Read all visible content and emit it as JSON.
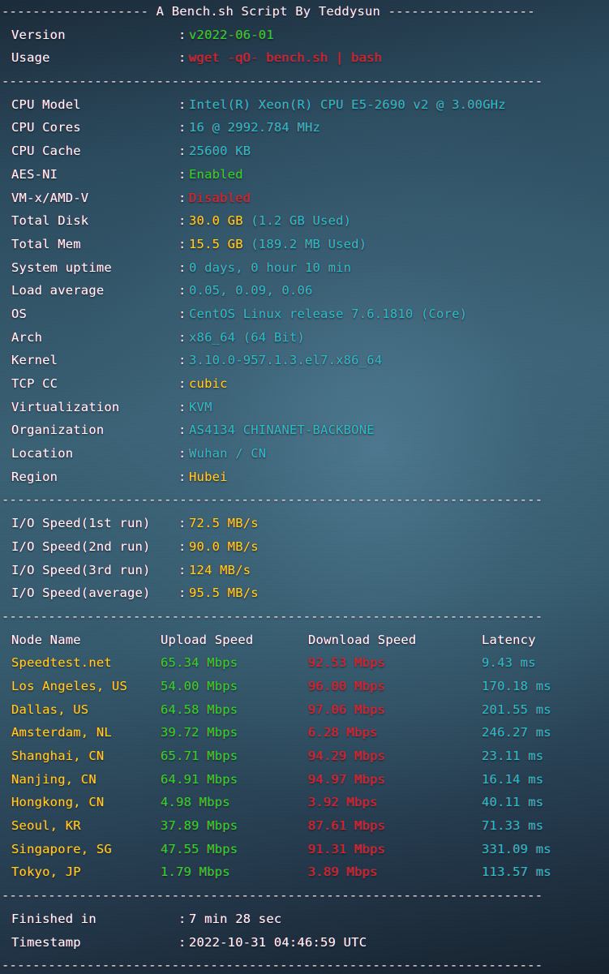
{
  "header": {
    "title": "A Bench.sh Script By Teddysun",
    "dash_left": "-------------------",
    "dash_right": "-------------------",
    "separator": "----------------------------------------------------------------------"
  },
  "script_info": {
    "rows": [
      {
        "label": "Version",
        "colon": ":",
        "value": "v2022-06-01",
        "color": "green"
      },
      {
        "label": "Usage",
        "colon": ":",
        "value": "wget -qO- bench.sh | bash",
        "color": "red"
      }
    ]
  },
  "system_info": {
    "rows": [
      {
        "label": "CPU Model",
        "colon": ":",
        "value": "Intel(R) Xeon(R) CPU E5-2690 v2 @ 3.00GHz",
        "color": "cyan"
      },
      {
        "label": "CPU Cores",
        "colon": ":",
        "value": "16 @ 2992.784 MHz",
        "color": "cyan"
      },
      {
        "label": "CPU Cache",
        "colon": ":",
        "value": "25600 KB",
        "color": "cyan"
      },
      {
        "label": "AES-NI",
        "colon": ":",
        "value": "Enabled",
        "color": "green"
      },
      {
        "label": "VM-x/AMD-V",
        "colon": ":",
        "value": "Disabled",
        "color": "red"
      },
      {
        "label": "Total Disk",
        "colon": ":",
        "value": "30.0 GB",
        "color": "yellow",
        "suffix": " (1.2 GB Used)",
        "suffix_color": "cyan"
      },
      {
        "label": "Total Mem",
        "colon": ":",
        "value": "15.5 GB",
        "color": "yellow",
        "suffix": " (189.2 MB Used)",
        "suffix_color": "cyan"
      },
      {
        "label": "System uptime",
        "colon": ":",
        "value": "0 days, 0 hour 10 min",
        "color": "cyan"
      },
      {
        "label": "Load average",
        "colon": ":",
        "value": "0.05, 0.09, 0.06",
        "color": "cyan"
      },
      {
        "label": "OS",
        "colon": ":",
        "value": "CentOS Linux release 7.6.1810 (Core)",
        "color": "cyan"
      },
      {
        "label": "Arch",
        "colon": ":",
        "value": "x86_64 (64 Bit)",
        "color": "cyan"
      },
      {
        "label": "Kernel",
        "colon": ":",
        "value": "3.10.0-957.1.3.el7.x86_64",
        "color": "cyan"
      },
      {
        "label": "TCP CC",
        "colon": ":",
        "value": "cubic",
        "color": "yellow"
      },
      {
        "label": "Virtualization",
        "colon": ":",
        "value": "KVM",
        "color": "cyan"
      },
      {
        "label": "Organization",
        "colon": ":",
        "value": "AS4134 CHINANET-BACKBONE",
        "color": "cyan"
      },
      {
        "label": "Location",
        "colon": ":",
        "value": "Wuhan / CN",
        "color": "cyan"
      },
      {
        "label": "Region",
        "colon": ":",
        "value": "Hubei",
        "color": "yellow"
      }
    ]
  },
  "io_speed": {
    "rows": [
      {
        "label": "I/O Speed(1st run)",
        "colon": ":",
        "value": "72.5 MB/s",
        "color": "yellow"
      },
      {
        "label": "I/O Speed(2nd run)",
        "colon": ":",
        "value": "90.0 MB/s",
        "color": "yellow"
      },
      {
        "label": "I/O Speed(3rd run)",
        "colon": ":",
        "value": "124 MB/s",
        "color": "yellow"
      },
      {
        "label": "I/O Speed(average)",
        "colon": ":",
        "value": "95.5 MB/s",
        "color": "yellow"
      }
    ]
  },
  "speedtest": {
    "columns": {
      "node": "Node Name",
      "upload": "Upload Speed",
      "download": "Download Speed",
      "latency": "Latency"
    },
    "rows": [
      {
        "node": "Speedtest.net",
        "upload": "65.34 Mbps",
        "download": "92.53 Mbps",
        "latency": "9.43 ms"
      },
      {
        "node": "Los Angeles, US",
        "upload": "54.00 Mbps",
        "download": "96.00 Mbps",
        "latency": "170.18 ms"
      },
      {
        "node": "Dallas, US",
        "upload": "64.58 Mbps",
        "download": "97.06 Mbps",
        "latency": "201.55 ms"
      },
      {
        "node": "Amsterdam, NL",
        "upload": "39.72 Mbps",
        "download": "6.28 Mbps",
        "latency": "246.27 ms"
      },
      {
        "node": "Shanghai, CN",
        "upload": "65.71 Mbps",
        "download": "94.29 Mbps",
        "latency": "23.11 ms"
      },
      {
        "node": "Nanjing, CN",
        "upload": "64.91 Mbps",
        "download": "94.97 Mbps",
        "latency": "16.14 ms"
      },
      {
        "node": "Hongkong, CN",
        "upload": "4.98 Mbps",
        "download": "3.92 Mbps",
        "latency": "40.11 ms"
      },
      {
        "node": "Seoul, KR",
        "upload": "37.89 Mbps",
        "download": "87.61 Mbps",
        "latency": "71.33 ms"
      },
      {
        "node": "Singapore, SG",
        "upload": "47.55 Mbps",
        "download": "91.31 Mbps",
        "latency": "331.09 ms"
      },
      {
        "node": "Tokyo, JP",
        "upload": "1.79 Mbps",
        "download": "3.89 Mbps",
        "latency": "113.57 ms"
      }
    ]
  },
  "footer": {
    "rows": [
      {
        "label": "Finished in",
        "colon": ":",
        "value": "7 min 28 sec",
        "color": "white"
      },
      {
        "label": "Timestamp",
        "colon": ":",
        "value": "2022-10-31 04:46:59 UTC",
        "color": "white"
      }
    ]
  },
  "colors": {
    "cyan": "#19c6c6",
    "green": "#1fe01f",
    "red": "#e22121",
    "yellow": "#ffd90a",
    "white": "#ffffff",
    "background_top": "#1a2a38",
    "background_mid": "#3a6175",
    "background_bottom": "#16222e"
  }
}
